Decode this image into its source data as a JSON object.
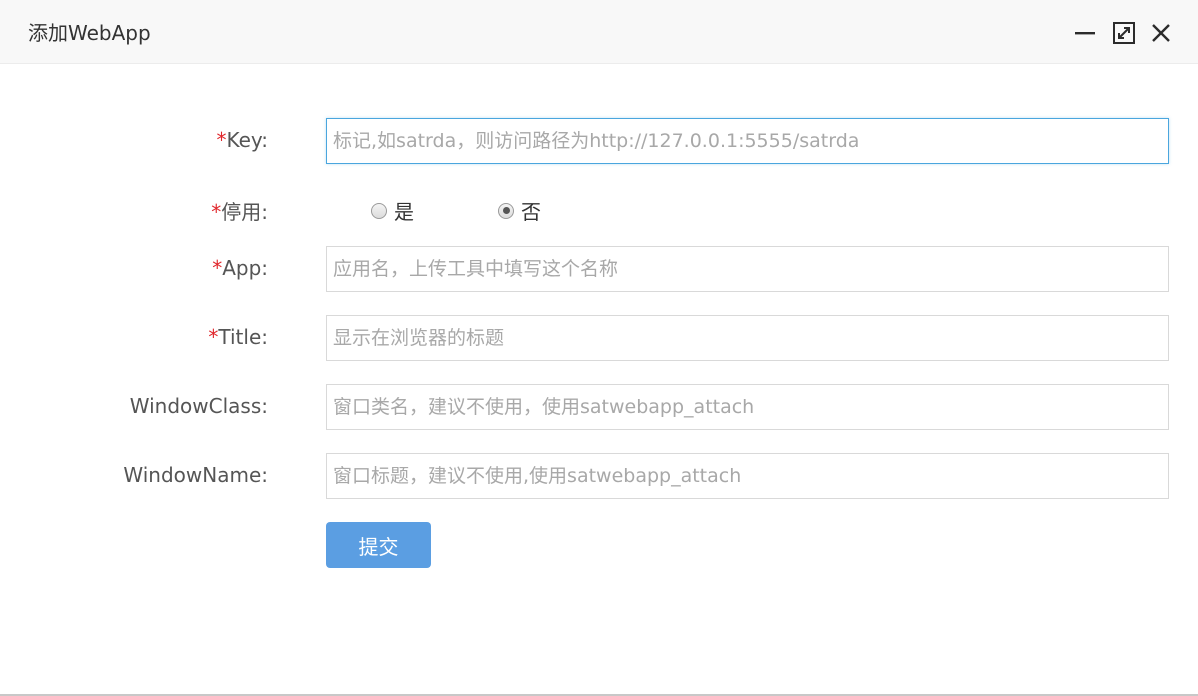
{
  "window": {
    "title": "添加WebApp"
  },
  "form": {
    "required_mark": "*",
    "key": {
      "label": "Key:",
      "value": "",
      "placeholder": "标记,如satrda，则访问路径为http://127.0.0.1:5555/satrda"
    },
    "disabled": {
      "label": "停用:",
      "options": [
        {
          "label": "是",
          "checked": false
        },
        {
          "label": "否",
          "checked": true
        }
      ]
    },
    "app": {
      "label": "App:",
      "value": "",
      "placeholder": "应用名，上传工具中填写这个名称"
    },
    "title": {
      "label": "Title:",
      "value": "",
      "placeholder": "显示在浏览器的标题"
    },
    "window_class": {
      "label": "WindowClass:",
      "value": "",
      "placeholder": "窗口类名，建议不使用，使用satwebapp_attach"
    },
    "window_name": {
      "label": "WindowName:",
      "value": "",
      "placeholder": "窗口标题，建议不使用,使用satwebapp_attach"
    },
    "submit_label": "提交"
  },
  "icons": {
    "minimize": "minimize-icon",
    "maximize": "maximize-icon",
    "close": "close-icon"
  },
  "colors": {
    "required": "#e0262b",
    "accent": "#5b9ee2",
    "focus_border": "#4aa6de"
  }
}
